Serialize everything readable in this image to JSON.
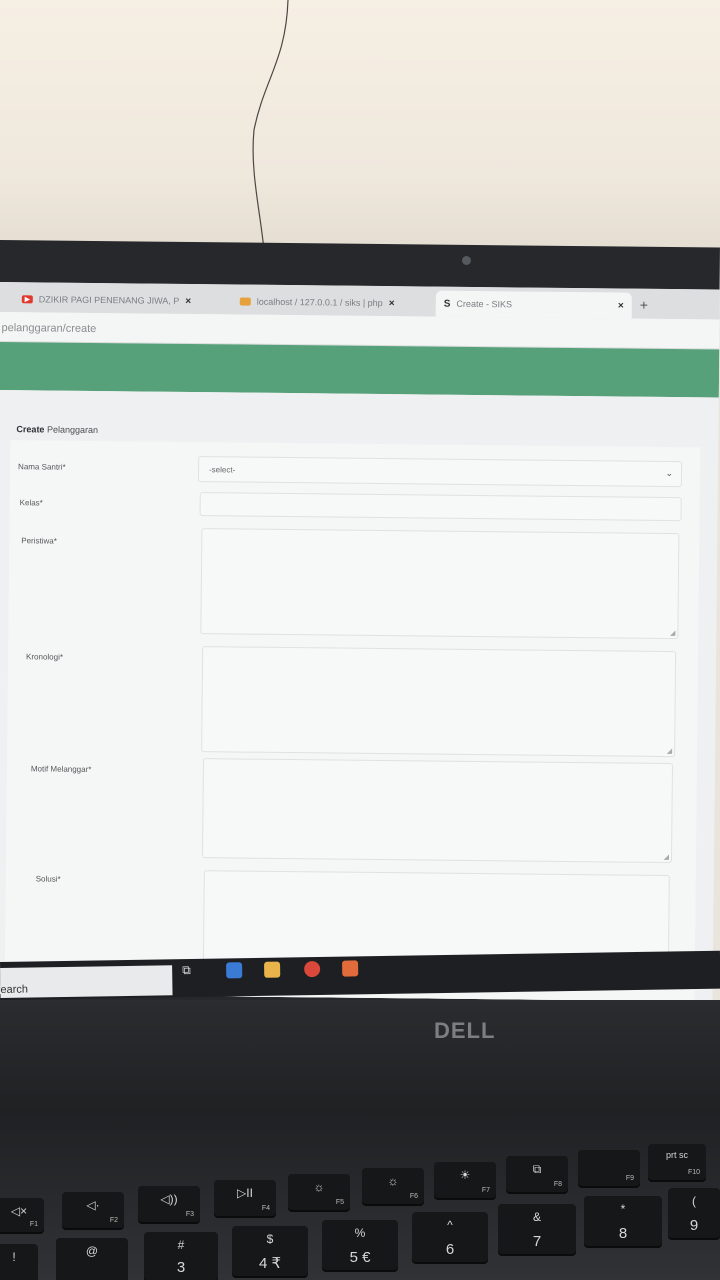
{
  "browser": {
    "tabs": [
      {
        "label": "DZIKIR PAGI PENENANG JIWA, P",
        "close": "×"
      },
      {
        "label": "localhost / 127.0.0.1 / siks | php",
        "close": "×"
      },
      {
        "label": "Create - SIKS",
        "close": "×"
      }
    ],
    "new_tab": "+",
    "url": "pelanggaran/create"
  },
  "page": {
    "title_bold": "Create",
    "title_rest": " Pelanggaran"
  },
  "form": {
    "nama_santri_label": "Nama Santri*",
    "nama_santri_value": "-select-",
    "kelas_label": "Kelas*",
    "peristiwa_label": "Peristiwa*",
    "kronologi_label": "Kronologi*",
    "motif_label": "Motif Melanggar*",
    "solusi_label": "Solusi*"
  },
  "taskbar": {
    "search_text": "earch"
  },
  "laptop": {
    "logo": "DELL"
  },
  "keyboard": {
    "f_keys": [
      {
        "icon": "◁×",
        "sub": "F1"
      },
      {
        "icon": "◁·",
        "sub": "F2"
      },
      {
        "icon": "◁))",
        "sub": "F3"
      },
      {
        "icon": "▷II",
        "sub": "F4"
      },
      {
        "icon": "☼",
        "sub": "F5"
      },
      {
        "icon": "☼",
        "sub": "F6"
      },
      {
        "icon": "☀",
        "sub": "F7"
      },
      {
        "icon": "⧉",
        "sub": "F8"
      },
      {
        "icon": "",
        "sub": "F9"
      },
      {
        "icon": "prt sc",
        "sub": "F10"
      }
    ],
    "num_keys": [
      {
        "top": "!",
        "bottom": ""
      },
      {
        "top": "@",
        "bottom": ""
      },
      {
        "top": "#",
        "bottom": "3"
      },
      {
        "top": "$",
        "bottom": "4 ₹"
      },
      {
        "top": "%",
        "bottom": "5 €"
      },
      {
        "top": "^",
        "bottom": "6"
      },
      {
        "top": "&",
        "bottom": "7"
      },
      {
        "top": "*",
        "bottom": "8"
      },
      {
        "top": "(",
        "bottom": "9"
      }
    ]
  }
}
